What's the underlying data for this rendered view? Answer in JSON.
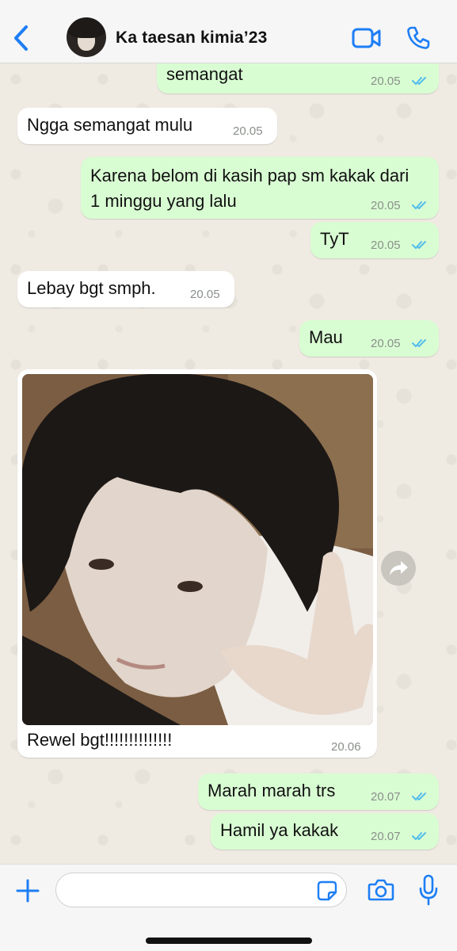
{
  "header": {
    "contact_name": "Ka taesan kimia’23",
    "back_icon": "chevron-left-icon",
    "video_icon": "video-camera-icon",
    "call_icon": "phone-icon",
    "accent_color": "#1d7ef5"
  },
  "messages": [
    {
      "direction": "out",
      "text": "semangat",
      "time": "20.05",
      "status": "read"
    },
    {
      "direction": "in",
      "text": "Ngga semangat mulu",
      "time": "20.05"
    },
    {
      "direction": "out",
      "text_line1": "Karena belom di kasih pap sm kakak dari",
      "text_line2": "1 minggu yang lalu",
      "time": "20.05",
      "status": "read"
    },
    {
      "direction": "out",
      "text": "TyT",
      "time": "20.05",
      "status": "read"
    },
    {
      "direction": "in",
      "text": "Lebay bgt smph.",
      "time": "20.05"
    },
    {
      "direction": "out",
      "text": "Mau",
      "time": "20.05",
      "status": "read"
    },
    {
      "direction": "in",
      "type": "photo",
      "caption": "Rewel bgt!!!!!!!!!!!!!!",
      "time": "20.06"
    },
    {
      "direction": "out",
      "text": "Marah marah trs",
      "time": "20.07",
      "status": "read"
    },
    {
      "direction": "out",
      "text": "Hamil ya kakak",
      "time": "20.07",
      "status": "read"
    }
  ],
  "colors": {
    "incoming_bubble": "#ffffff",
    "outgoing_bubble": "#d9fdd3",
    "read_ticks": "#53bdeb",
    "chat_background": "#efeae2"
  },
  "input_bar": {
    "message_value": "",
    "plus_icon": "plus-icon",
    "sticker_icon": "sticker-icon",
    "camera_icon": "camera-icon",
    "mic_icon": "microphone-icon"
  }
}
